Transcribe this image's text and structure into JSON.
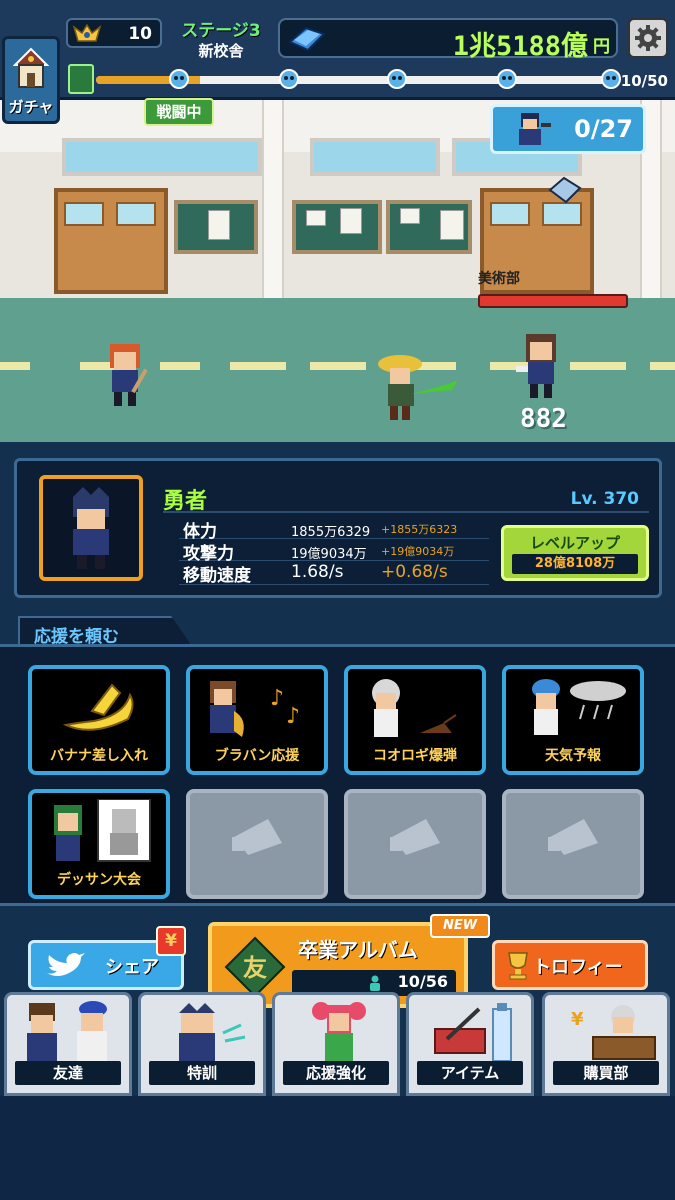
{
  "hud": {
    "gacha_label": "ガチャ",
    "player_level": "10",
    "stage_title": "ステージ3",
    "stage_name": "新校舎",
    "money_amount": "1兆5188億",
    "money_unit": "円",
    "wave_count": "10/50",
    "wave_progress": 0.2,
    "battle_status": "戦闘中"
  },
  "battle": {
    "kill_count": "0/27",
    "enemy_name": "美術部",
    "damage_number": "882"
  },
  "hero": {
    "name": "勇者",
    "level": "Lv. 370",
    "stats": [
      {
        "label": "体力",
        "value": "1855万6329",
        "bonus": "+1855万6323"
      },
      {
        "label": "攻撃力",
        "value": "19億9034万",
        "bonus": "+19億9034万"
      },
      {
        "label": "移動速度",
        "value": "1.68/s",
        "bonus": "+0.68/s"
      }
    ],
    "levelup_label": "レベルアップ",
    "levelup_cost": "28億8108万"
  },
  "support": {
    "section_title": "応援を頼む",
    "skills": [
      {
        "name": "バナナ差し入れ",
        "unlocked": true
      },
      {
        "name": "ブラバン応援",
        "unlocked": true
      },
      {
        "name": "コオロギ爆弾",
        "unlocked": true
      },
      {
        "name": "天気予報",
        "unlocked": true
      },
      {
        "name": "デッサン大会",
        "unlocked": true
      },
      {
        "name": "",
        "unlocked": false
      },
      {
        "name": "",
        "unlocked": false
      },
      {
        "name": "",
        "unlocked": false
      }
    ]
  },
  "bottom": {
    "share_label": "シェア",
    "share_badge": "¥",
    "album_title": "卒業アルバム",
    "album_count": "10/56",
    "album_badge": "NEW",
    "album_book_glyph": "友",
    "trophy_label": "トロフィー",
    "tabs": [
      "友達",
      "特訓",
      "応援強化",
      "アイテム",
      "購買部"
    ]
  },
  "colors": {
    "accent_green": "#b8ff5c",
    "panel_bg": "#0c1f36",
    "frame_blue": "#39a8e0",
    "orange": "#f29a1c"
  }
}
